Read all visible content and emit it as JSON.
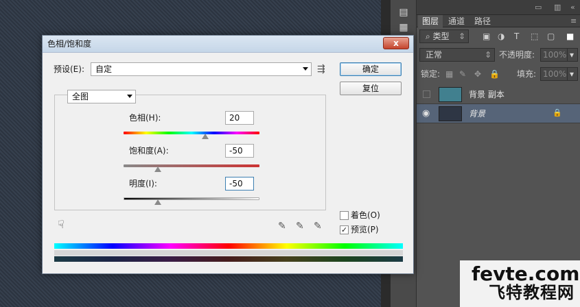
{
  "dialog": {
    "title": "色相/饱和度",
    "close_label": "x",
    "preset_label": "预设(E):",
    "preset_value": "自定",
    "ok_label": "确定",
    "reset_label": "复位",
    "channel_value": "全图",
    "hue": {
      "label": "色相(H):",
      "value": "20",
      "fraction": 0.6
    },
    "saturation": {
      "label": "饱和度(A):",
      "value": "-50",
      "fraction": 0.25
    },
    "lightness": {
      "label": "明度(I):",
      "value": "-50",
      "fraction": 0.25
    },
    "colorize_label": "着色(O)",
    "colorize_checked": false,
    "preview_label": "预览(P)",
    "preview_checked": true
  },
  "panel": {
    "tabs": [
      {
        "label": "图层",
        "active": true
      },
      {
        "label": "通道",
        "active": false
      },
      {
        "label": "路径",
        "active": false
      }
    ],
    "filter_label": "类型",
    "blend_mode": "正常",
    "opacity_label": "不透明度:",
    "opacity_value": "100%",
    "lock_label": "锁定:",
    "fill_label": "填充:",
    "fill_value": "100%",
    "layers": [
      {
        "name": "背景 副本",
        "visible": false,
        "selected": false,
        "thumb_color": "#41808f"
      },
      {
        "name": "背景",
        "visible": true,
        "selected": true,
        "thumb_color": "#2e3644"
      }
    ]
  },
  "watermark": {
    "line1": "fevte.com",
    "line2": "飞特教程网"
  },
  "colors": {
    "accent": "#3c7fb1",
    "layer_selected": "#566478"
  }
}
